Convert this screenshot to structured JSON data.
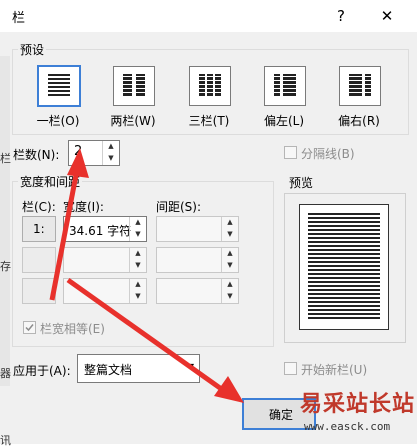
{
  "window": {
    "title": "栏",
    "help_label": "?",
    "close_label": "✕"
  },
  "presets": {
    "group_label": "预设",
    "items": [
      {
        "label": "一栏(O)",
        "icon": "one-column-icon",
        "selected": true
      },
      {
        "label": "两栏(W)",
        "icon": "two-column-icon",
        "selected": false
      },
      {
        "label": "三栏(T)",
        "icon": "three-column-icon",
        "selected": false
      },
      {
        "label": "偏左(L)",
        "icon": "left-column-icon",
        "selected": false
      },
      {
        "label": "偏右(R)",
        "icon": "right-column-icon",
        "selected": false
      }
    ]
  },
  "columns": {
    "label": "栏数(N):",
    "value": "2"
  },
  "separator": {
    "label": "分隔线(B)",
    "checked": false,
    "enabled": false
  },
  "width_spacing": {
    "group_label": "宽度和间距",
    "col_header": "栏(C):",
    "width_header": "宽度(I):",
    "spacing_header": "间距(S):",
    "rows": [
      {
        "col": "1:",
        "width": "34.61 字符",
        "spacing": ""
      },
      {
        "col": "",
        "width": "",
        "spacing": ""
      },
      {
        "col": "",
        "width": "",
        "spacing": ""
      }
    ]
  },
  "equal_width": {
    "label": "栏宽相等(E)",
    "checked": true,
    "enabled": false
  },
  "preview": {
    "label": "预览"
  },
  "apply_to": {
    "label": "应用于(A):",
    "value": "整篇文档"
  },
  "new_column": {
    "label": "开始新栏(U)",
    "checked": false,
    "enabled": false
  },
  "ok_button": {
    "label": "确定"
  },
  "background_app": {
    "side_chars": [
      "栏",
      "存",
      "器",
      "讯"
    ]
  },
  "watermark": {
    "line1": "易采站长站",
    "line2": "www.easck.com"
  },
  "colors": {
    "accent": "#3d7fd6",
    "arrow": "#e8312c"
  }
}
